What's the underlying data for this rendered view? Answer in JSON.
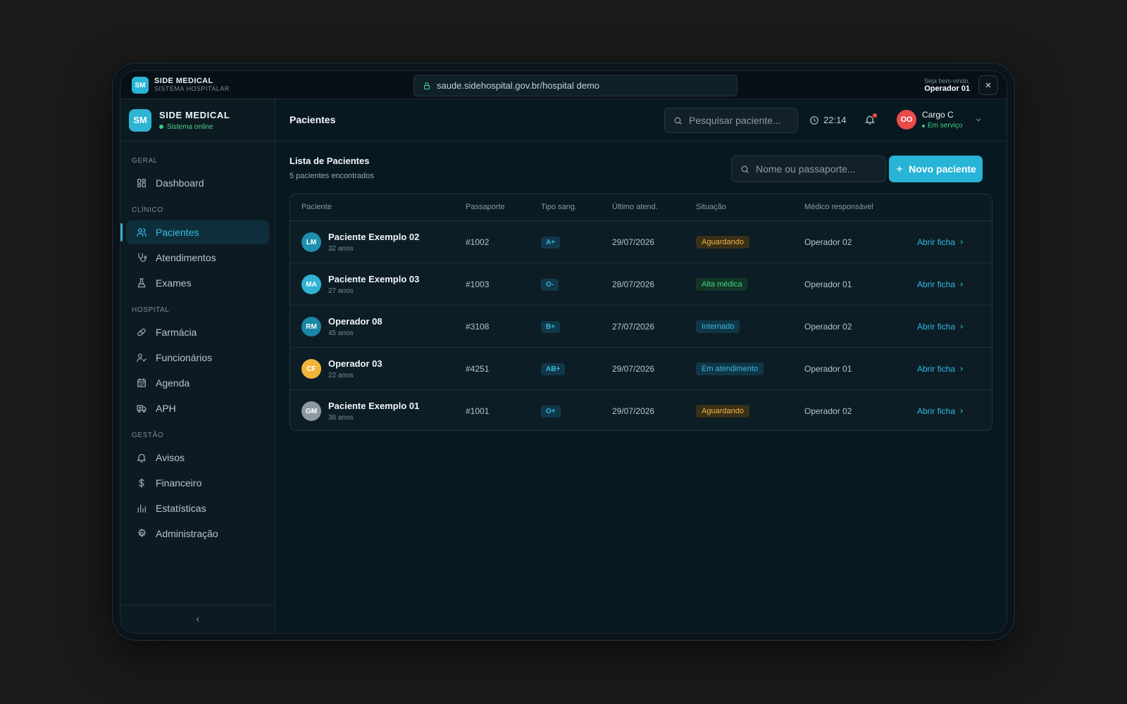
{
  "topbar": {
    "logo": "SM",
    "title": "SIDE MEDICAL",
    "subtitle": "SISTEMA HOSPITALAR",
    "url": "saude.sidehospital.gov.br/hospital demo",
    "welcome_label": "Seja bem-vindo,",
    "welcome_user": "Operador 01"
  },
  "sidebar": {
    "logo": "SM",
    "title": "SIDE MEDICAL",
    "status": "Sistema online",
    "sections": [
      {
        "label": "GERAL",
        "items": [
          {
            "label": "Dashboard",
            "icon": "dashboard-icon"
          }
        ]
      },
      {
        "label": "CLÍNICO",
        "items": [
          {
            "label": "Pacientes",
            "icon": "users-icon",
            "active": true
          },
          {
            "label": "Atendimentos",
            "icon": "stethoscope-icon"
          },
          {
            "label": "Exames",
            "icon": "flask-icon"
          }
        ]
      },
      {
        "label": "HOSPITAL",
        "items": [
          {
            "label": "Farmácia",
            "icon": "pill-icon"
          },
          {
            "label": "Funcionários",
            "icon": "user-check-icon"
          },
          {
            "label": "Agenda",
            "icon": "calendar-icon"
          },
          {
            "label": "APH",
            "icon": "ambulance-icon"
          }
        ]
      },
      {
        "label": "GESTÃO",
        "items": [
          {
            "label": "Avisos",
            "icon": "bell-icon"
          },
          {
            "label": "Financeiro",
            "icon": "dollar-icon"
          },
          {
            "label": "Estatísticas",
            "icon": "bar-chart-icon"
          },
          {
            "label": "Administração",
            "icon": "gear-icon"
          }
        ]
      }
    ]
  },
  "header": {
    "title": "Pacientes",
    "search_placeholder": "Pesquisar paciente...",
    "time": "22:14",
    "user_initials": "OO",
    "user_name": "Cargo C",
    "user_status": "Em serviço"
  },
  "list": {
    "title": "Lista de Pacientes",
    "count": "5 pacientes encontrados",
    "search_placeholder": "Nome ou passaporte...",
    "new_button": "Novo paciente"
  },
  "table": {
    "columns": [
      "Paciente",
      "Passaporte",
      "Tipo sang.",
      "Último atend.",
      "Situação",
      "Médico responsável"
    ],
    "open_label": "Abrir ficha",
    "rows": [
      {
        "initials": "LM",
        "avatar_color": "#1f8fb0",
        "name": "Paciente Exemplo 02",
        "age": "32 anos",
        "passport": "#1002",
        "blood": "A+",
        "last": "29/07/2026",
        "status": "Aguardando",
        "status_kind": "waiting",
        "doctor": "Operador 02"
      },
      {
        "initials": "MA",
        "avatar_color": "#2fb3d3",
        "name": "Paciente Exemplo 03",
        "age": "27 anos",
        "passport": "#1003",
        "blood": "O-",
        "last": "28/07/2026",
        "status": "Alta médica",
        "status_kind": "discharged",
        "doctor": "Operador 01"
      },
      {
        "initials": "RM",
        "avatar_color": "#1c86a6",
        "name": "Operador 08",
        "age": "45 anos",
        "passport": "#3108",
        "blood": "B+",
        "last": "27/07/2026",
        "status": "Internado",
        "status_kind": "admitted",
        "doctor": "Operador 02"
      },
      {
        "initials": "CF",
        "avatar_color": "#f0b43a",
        "name": "Operador 03",
        "age": "22 anos",
        "passport": "#4251",
        "blood": "AB+",
        "last": "29/07/2026",
        "status": "Em atendimento",
        "status_kind": "attending",
        "doctor": "Operador 01"
      },
      {
        "initials": "GM",
        "avatar_color": "#8e9aa3",
        "name": "Paciente Exemplo 01",
        "age": "38 anos",
        "passport": "#1001",
        "blood": "O+",
        "last": "29/07/2026",
        "status": "Aguardando",
        "status_kind": "waiting",
        "doctor": "Operador 02"
      }
    ]
  },
  "status_colors": {
    "waiting": {
      "fg": "#f2b54a",
      "bg": "#3a2f17"
    },
    "discharged": {
      "fg": "#3fd58a",
      "bg": "#123626"
    },
    "admitted": {
      "fg": "#39b8e0",
      "bg": "#113747"
    },
    "attending": {
      "fg": "#39b8e0",
      "bg": "#113747"
    }
  }
}
